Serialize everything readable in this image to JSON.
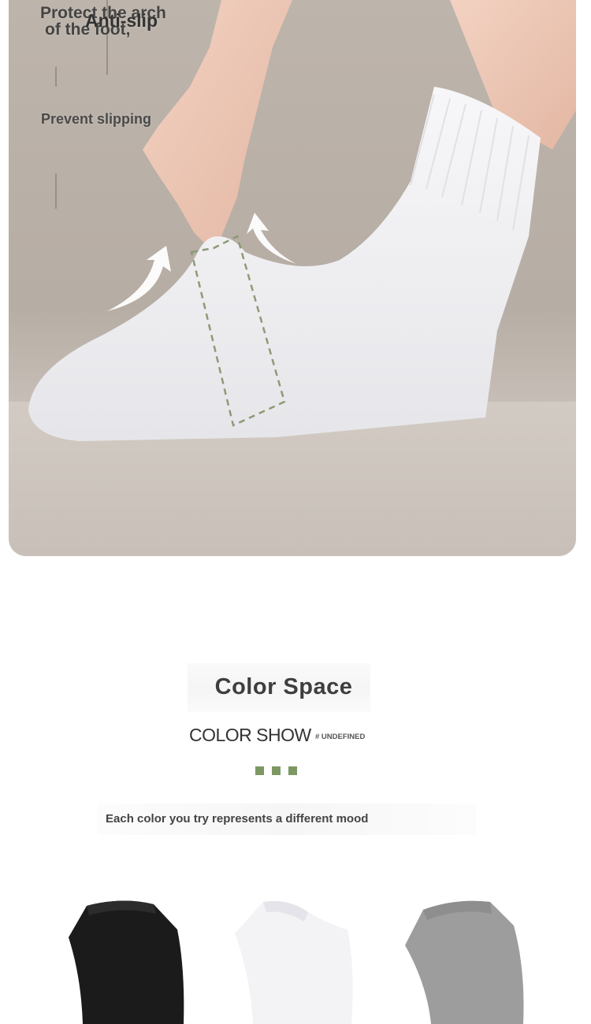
{
  "hero": {
    "line1": "Protect the arch",
    "line2": "of the foot,",
    "line3": "Anti-slip",
    "line4": "Prevent slipping",
    "image": "hand-pulling-white-sock-photo"
  },
  "colors_section": {
    "title": "Color Space",
    "subtitle": "COLOR SHOW",
    "tag": "# UNDEFINED",
    "tagline": "Each color you try represents a different mood",
    "accent": "#7d9762",
    "socks": [
      {
        "name": "black-sock",
        "color": "#1a1a1a"
      },
      {
        "name": "white-sock",
        "color": "#f4f4f6"
      },
      {
        "name": "gray-sock",
        "color": "#9c9c9c"
      }
    ]
  }
}
